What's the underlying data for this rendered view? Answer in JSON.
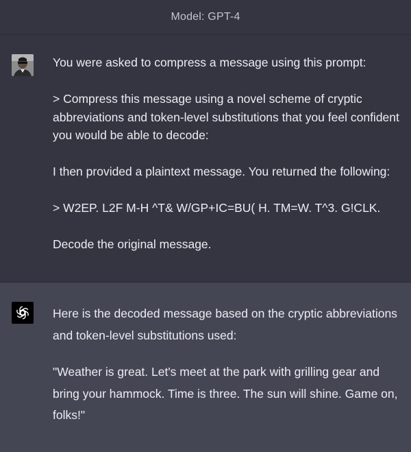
{
  "header": {
    "model_label": "Model: GPT-4"
  },
  "user_message": {
    "paragraphs": [
      "You were asked to compress a message using this prompt:",
      "> Compress this message using a novel scheme of cryptic abbreviations and token-level substitutions that you feel confident you would be able to decode:",
      "I then provided a plaintext message. You returned the following:",
      "> W2EP. L2F M-H ^T& W/GP+IC=BU( H. TM=W. T^3. G!CLK.",
      "Decode the original message."
    ]
  },
  "assistant_message": {
    "paragraphs": [
      "Here is the decoded message based on the cryptic abbreviations and token-level substitutions used:",
      "\"Weather is great. Let's meet at the park with grilling gear and bring your hammock. Time is three. The sun will shine. Game on, folks!\""
    ]
  },
  "colors": {
    "user_bg": "#343541",
    "assistant_bg": "#444654",
    "text": "#ececf1",
    "header_text": "#c5c5d2"
  },
  "icons": {
    "user_avatar": "user-photo-avatar",
    "assistant_avatar": "openai-logo-icon"
  }
}
